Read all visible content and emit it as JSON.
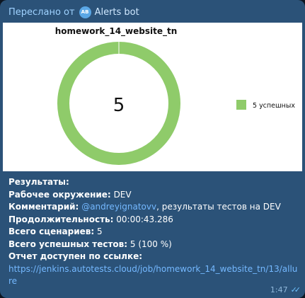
{
  "forward": {
    "prefix": "Переслано от",
    "avatar_initials": "AB",
    "bot_name": "Alerts bot"
  },
  "chart_data": {
    "type": "pie",
    "title": "homework_14_website_tn",
    "center_label": "5",
    "categories": [
      "5 успешных"
    ],
    "values": [
      5
    ],
    "colors": [
      "#8fcb6a"
    ],
    "legend": "right"
  },
  "caption": {
    "results_label": "Результаты:",
    "env_label": "Рабочее окружение:",
    "env_value": "DEV",
    "comment_label": "Комментарий:",
    "comment_mention": "@andreyignatovv",
    "comment_rest": ", результаты тестов на DEV",
    "duration_label": "Продолжительность:",
    "duration_value": "00:00:43.286",
    "total_label": "Всего сценариев:",
    "total_value": "5",
    "passed_label": "Всего успешных тестов:",
    "passed_value": "5 (100 %)",
    "report_label": "Отчет доступен по ссылке:",
    "report_url": "https://jenkins.autotests.cloud/job/homework_14_website_tn/13/allure"
  },
  "meta": {
    "time": "1:47",
    "read_ticks": "✓✓"
  }
}
